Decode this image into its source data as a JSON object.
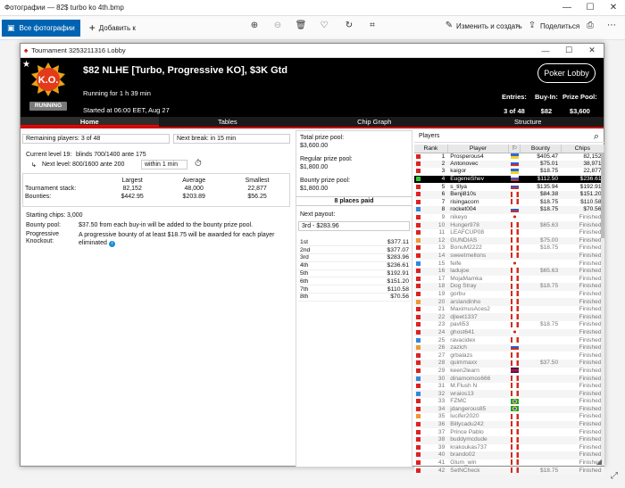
{
  "photos_window": {
    "title": "Фотографии — 82$ turbo ko 4th.bmp",
    "all_photos": "Все фотографии",
    "add_to": "Добавить к",
    "edit_create": "Изменить и создать",
    "share": "Поделиться"
  },
  "lobby": {
    "window_title": "Tournament 3253211316 Lobby",
    "title": "$82 NLHE [Turbo, Progressive KO], $3K Gtd",
    "running_for": "Running for 1 h 39 min",
    "started": "Started at 06:00 EET, Aug 27",
    "logo_text": "K.O.",
    "status_badge": "RUNNING",
    "poker_lobby": "Poker Lobby",
    "entries_label": "Entries:",
    "entries_value": "3 of 48",
    "buyin_label": "Buy-In:",
    "buyin_value": "$82",
    "prize_label": "Prize Pool:",
    "prize_value": "$3,600",
    "tabs": [
      "Home",
      "Tables",
      "Chip Graph",
      "Structure"
    ]
  },
  "home": {
    "remaining": "Remaining players: 3 of 48",
    "next_break": "Next break: in 15 min",
    "current_level": "Current level 19:",
    "current_blinds": "blinds 700/1400 ante 175",
    "next_level": "Next level:",
    "next_blinds": "800/1600 ante 200",
    "within": "within 1 min",
    "stack_headers": [
      "",
      "Largest",
      "Average",
      "Smallest"
    ],
    "stack_rows": [
      [
        "Tournament stack:",
        "82,152",
        "48,000",
        "22,877"
      ],
      [
        "Bounties:",
        "$442.95",
        "$203.89",
        "$56.25"
      ]
    ],
    "starting_chips_label": "Starting chips:",
    "starting_chips": "3,000",
    "bounty_pool_label": "Bounty pool:",
    "bounty_pool": "$37.50 from each buy-in will be added to the bounty prize pool.",
    "pk_label": "Progressive Knockout:",
    "pk_text": "A progressive bounty of at least $18.75 will be awarded for each player eliminated"
  },
  "prizes": {
    "total_label": "Total prize pool:",
    "total": "$3,600.00",
    "regular_label": "Regular prize pool:",
    "regular": "$1,800.00",
    "bounty_label": "Bounty prize pool:",
    "bounty": "$1,800.00",
    "places_paid": "8 places paid",
    "next_payout_label": "Next payout:",
    "next_payout": "3rd - $283.96",
    "payouts": [
      [
        "1st",
        "$377.11"
      ],
      [
        "2nd",
        "$377.07"
      ],
      [
        "3rd",
        "$283.96"
      ],
      [
        "4th",
        "$236.61"
      ],
      [
        "5th",
        "$192.91"
      ],
      [
        "6th",
        "$151.20"
      ],
      [
        "7th",
        "$110.58"
      ],
      [
        "8th",
        "$70.56"
      ]
    ]
  },
  "players": {
    "header": "Players",
    "columns": [
      "Rank",
      "Player",
      "",
      "Bounty",
      "Chips"
    ],
    "rows": [
      [
        "1",
        "Prosperous4",
        "$405.47",
        "82,152",
        "#d22",
        "ua"
      ],
      [
        "2",
        "Antonovec",
        "$75.01",
        "38,971",
        "#d22",
        "ru"
      ],
      [
        "3",
        "kaigor",
        "$18.75",
        "22,877",
        "#d22",
        "ua"
      ],
      [
        "4",
        "EugeneShev",
        "$112.50",
        "$236.61",
        "#3c3",
        "ru"
      ],
      [
        "5",
        "s_tilya",
        "$135.94",
        "$192.91",
        "#d22",
        "ru"
      ],
      [
        "6",
        "Benji810s",
        "$84.38",
        "$151.20",
        "#d22",
        "ca"
      ],
      [
        "7",
        "risingacorn",
        "$18.75",
        "$110.58",
        "#d22",
        "ca"
      ],
      [
        "8",
        "rocket004",
        "$18.75",
        "$70.56",
        "#38d",
        "ru"
      ],
      [
        "9",
        "nikeyo",
        "",
        "Finished",
        "#d22",
        "jp"
      ],
      [
        "10",
        "Hunger978",
        "$65.63",
        "Finished",
        "#d22",
        "ca"
      ],
      [
        "11",
        "LEAFCUP08",
        "",
        "Finished",
        "#d22",
        "ca"
      ],
      [
        "12",
        "GUNDIAS",
        "$75.00",
        "Finished",
        "#e93",
        "ca"
      ],
      [
        "13",
        "BonuM2222",
        "$18.75",
        "Finished",
        "#d22",
        "ca"
      ],
      [
        "14",
        "sweetmellons",
        "",
        "Finished",
        "#d22",
        "ca"
      ],
      [
        "15",
        "feife",
        "",
        "Finished",
        "#38d",
        "jp"
      ],
      [
        "16",
        "ladujoe",
        "$65.63",
        "Finished",
        "#d22",
        "ca"
      ],
      [
        "17",
        "MojaMamka",
        "",
        "Finished",
        "#d22",
        "ca"
      ],
      [
        "18",
        "Dog Stray",
        "$18.75",
        "Finished",
        "#d22",
        "ca"
      ],
      [
        "19",
        "gorbu",
        "",
        "Finished",
        "#d22",
        "ca"
      ],
      [
        "20",
        "arslandinho",
        "",
        "Finished",
        "#e93",
        "ca"
      ],
      [
        "21",
        "MaximusAces2",
        "",
        "Finished",
        "#d22",
        "ca"
      ],
      [
        "22",
        "djleet1337",
        "",
        "Finished",
        "#d22",
        "ca"
      ],
      [
        "23",
        "pavli53",
        "$18.75",
        "Finished",
        "#d22",
        "ca"
      ],
      [
        "24",
        "ghost641",
        "",
        "Finished",
        "#d22",
        "jp"
      ],
      [
        "25",
        "ravacidex",
        "",
        "Finished",
        "#38d",
        "ca"
      ],
      [
        "26",
        "zazich",
        "",
        "Finished",
        "#e93",
        "ru"
      ],
      [
        "27",
        "grbalazs",
        "",
        "Finished",
        "#d22",
        "ca"
      ],
      [
        "28",
        "quimmaxx",
        "$37.50",
        "Finished",
        "#d22",
        "ca"
      ],
      [
        "29",
        "keen2learn",
        "",
        "Finished",
        "#d22",
        "gb"
      ],
      [
        "30",
        "dinamomos666",
        "",
        "Finished",
        "#38d",
        "ca"
      ],
      [
        "31",
        "M.Flush N",
        "",
        "Finished",
        "#d22",
        "ca"
      ],
      [
        "32",
        "wraios13",
        "",
        "Finished",
        "#38d",
        "ca"
      ],
      [
        "33",
        "FZMC",
        "",
        "Finished",
        "#d22",
        "br"
      ],
      [
        "34",
        "jdangerous85",
        "",
        "Finished",
        "#d22",
        "br"
      ],
      [
        "35",
        "lucifer2020",
        "",
        "Finished",
        "#e93",
        "ca"
      ],
      [
        "36",
        "Billycadu242",
        "",
        "Finished",
        "#d22",
        "ca"
      ],
      [
        "37",
        "Prince Pablo",
        "",
        "Finished",
        "#d22",
        "ca"
      ],
      [
        "38",
        "buddymcdude",
        "",
        "Finished",
        "#d22",
        "ca"
      ],
      [
        "39",
        "krakoukas737",
        "",
        "Finished",
        "#d22",
        "ca"
      ],
      [
        "40",
        "brando02",
        "",
        "Finished",
        "#d22",
        "ca"
      ],
      [
        "41",
        "Glum_win",
        "",
        "Finished",
        "#d22",
        "ca"
      ],
      [
        "42",
        "SetNCheck",
        "$18.75",
        "Finished",
        "#d22",
        "ca"
      ]
    ]
  }
}
